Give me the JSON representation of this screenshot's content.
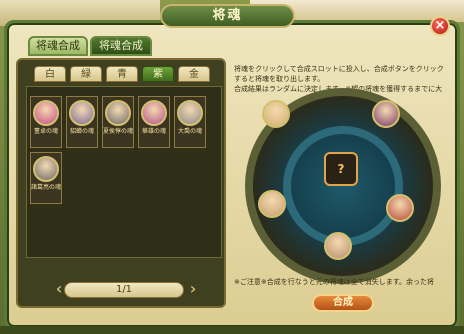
{
  "window": {
    "title": "将魂"
  },
  "tabs": [
    {
      "label": "将魂合成",
      "active": false
    },
    {
      "label": "将魂合成",
      "active": true
    }
  ],
  "subtabs": [
    {
      "label": "白",
      "active": false
    },
    {
      "label": "緑",
      "active": false
    },
    {
      "label": "青",
      "active": false
    },
    {
      "label": "紫",
      "active": true
    },
    {
      "label": "金",
      "active": false
    }
  ],
  "cards": [
    {
      "name": "董卓の魂",
      "color": "#c64b8a"
    },
    {
      "name": "貂蝉の魂",
      "color": "#7b6a9b"
    },
    {
      "name": "夏侯惇の魂",
      "color": "#6b6b6b"
    },
    {
      "name": "華雄の魂",
      "color": "#b5518a"
    },
    {
      "name": "大喬の魂",
      "color": "#8a8a8a"
    },
    {
      "name": "諸葛亮の魂",
      "color": "#6a6a6a"
    }
  ],
  "pager": {
    "text": "1/1",
    "prev": "‹",
    "next": "›"
  },
  "instructions": {
    "line1": "将魂をクリックして合成スロットに投入し、合成ボタンをクリックすると将魂を取り出します。",
    "line2": "合成結果はランダムに決定します。※望の将魂を獲得するまでに大"
  },
  "wheel": {
    "center": "?",
    "slots": [
      {
        "color": "#d0b070"
      },
      {
        "color": "#7b3a6b"
      },
      {
        "color": "#c6a070"
      },
      {
        "color": "#b54a3a"
      },
      {
        "color": "#b59070"
      }
    ]
  },
  "notice": "※ご注意※合成を行なうと元の将魂は全て消失します。余った将",
  "combine_label": "合成",
  "close_label": "×"
}
